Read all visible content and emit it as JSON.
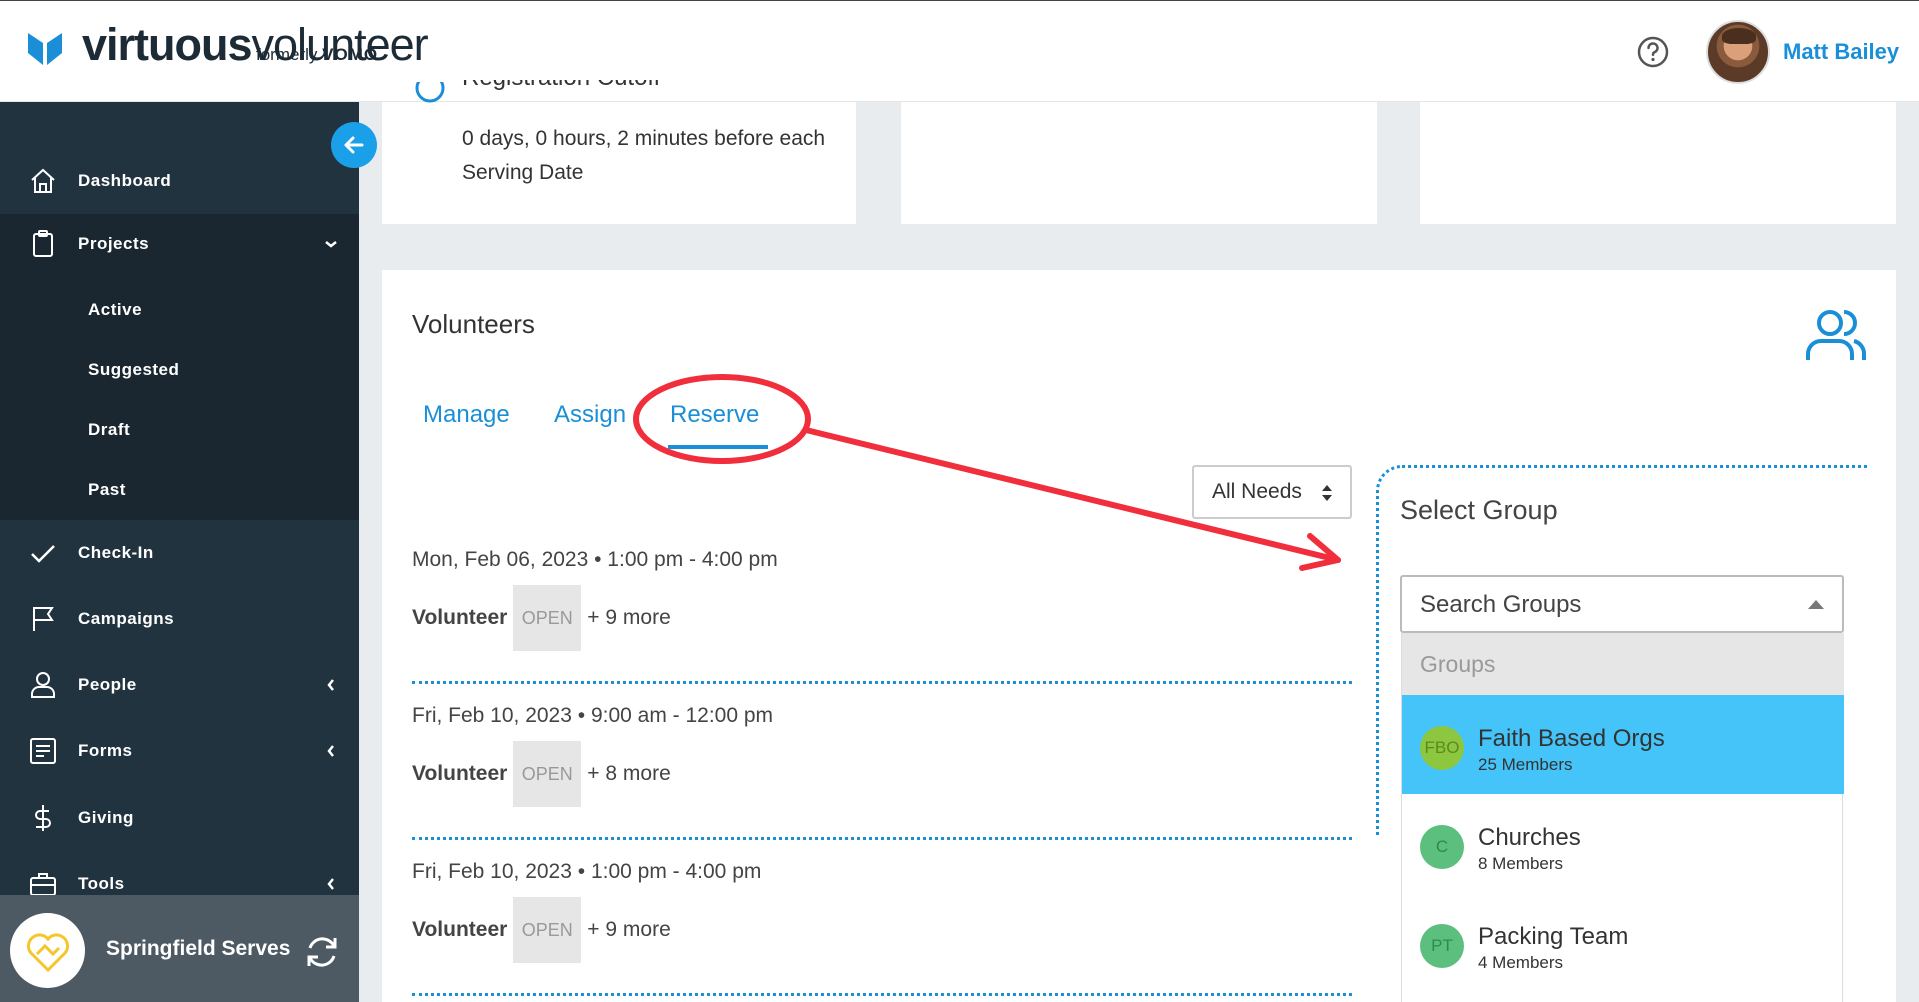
{
  "header": {
    "logo_bold": "virtuous",
    "logo_light": "volunteer",
    "logo_sub_prefix": "formerly",
    "logo_sub_brand": "VOMO",
    "user_name": "Matt Bailey"
  },
  "sidebar": {
    "items": [
      {
        "label": "Dashboard",
        "icon": "home-icon"
      },
      {
        "label": "Projects",
        "icon": "clipboard-icon"
      },
      {
        "label": "Check-In",
        "icon": "check-icon"
      },
      {
        "label": "Campaigns",
        "icon": "flag-icon"
      },
      {
        "label": "People",
        "icon": "person-icon"
      },
      {
        "label": "Forms",
        "icon": "form-icon"
      },
      {
        "label": "Giving",
        "icon": "dollar-icon"
      },
      {
        "label": "Tools",
        "icon": "toolbox-icon"
      }
    ],
    "project_sub": [
      "Active",
      "Suggested",
      "Draft",
      "Past"
    ],
    "org_name": "Springfield Serves"
  },
  "cutoff": {
    "title": "Registration Cutoff",
    "text": "0 days, 0 hours, 2 minutes before each Serving Date"
  },
  "volunteers": {
    "title": "Volunteers",
    "tabs": [
      "Manage",
      "Assign",
      "Reserve"
    ],
    "filter": "All Needs",
    "shifts": [
      {
        "date": "Mon, Feb 06, 2023 • 1:00 pm - 4:00 pm",
        "role": "Volunteer",
        "status": "OPEN",
        "more": "+ 9 more"
      },
      {
        "date": "Fri, Feb 10, 2023 • 9:00 am - 12:00 pm",
        "role": "Volunteer",
        "status": "OPEN",
        "more": "+ 8 more"
      },
      {
        "date": "Fri, Feb 10, 2023 • 1:00 pm - 4:00 pm",
        "role": "Volunteer",
        "status": "OPEN",
        "more": "+ 9 more"
      }
    ]
  },
  "select_group": {
    "title": "Select Group",
    "search_placeholder": "Search Groups",
    "header": "Groups",
    "groups": [
      {
        "initials": "FBO",
        "name": "Faith Based Orgs",
        "members": "25 Members"
      },
      {
        "initials": "C",
        "name": "Churches",
        "members": "8 Members"
      },
      {
        "initials": "PT",
        "name": "Packing Team",
        "members": "4 Members"
      }
    ]
  },
  "colors": {
    "brand_blue": "#1a8fd8",
    "sidebar_bg": "#223340",
    "selected_group": "#44c4f8",
    "annotation_red": "#f02e3c"
  }
}
